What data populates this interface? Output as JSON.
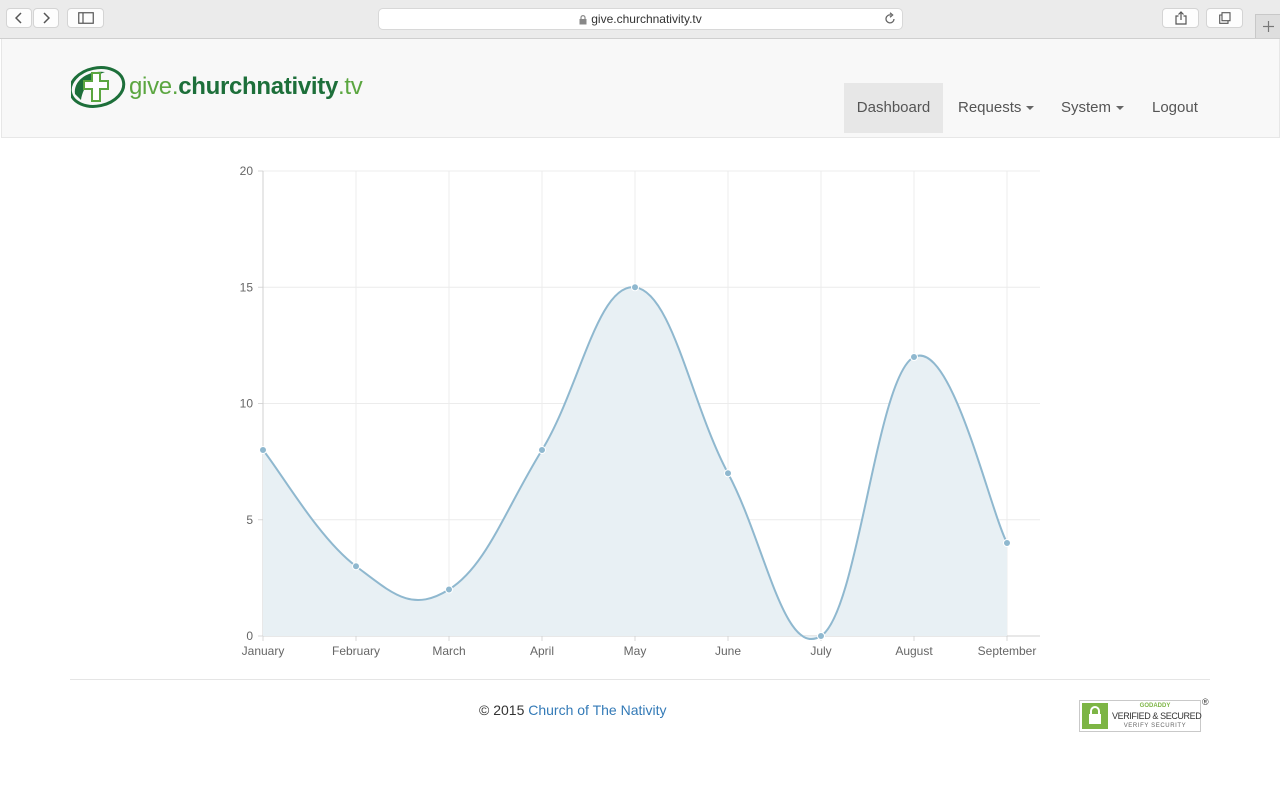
{
  "browser": {
    "url": "give.churchnativity.tv"
  },
  "brand": {
    "part1": "give.",
    "part2": "churchnativity",
    "part3": ".tv",
    "colors": {
      "light_green": "#5ba640",
      "dark_green": "#1d6f3a"
    }
  },
  "nav": {
    "dashboard": "Dashboard",
    "requests": "Requests",
    "system": "System",
    "logout": "Logout"
  },
  "chart_data": {
    "type": "line",
    "categories": [
      "January",
      "February",
      "March",
      "April",
      "May",
      "June",
      "July",
      "August",
      "September"
    ],
    "values": [
      8,
      3,
      2,
      8,
      15,
      7,
      0,
      12,
      4
    ],
    "ylim": [
      0,
      20
    ],
    "yticks": [
      0,
      5,
      10,
      15,
      20
    ],
    "grid": true,
    "filled": true,
    "colors": {
      "line": "#8fb8cf",
      "fill": "#e8f0f4",
      "point": "#8fb8cf"
    }
  },
  "footer": {
    "copyright": "© 2015",
    "link": "Church of The Nativity",
    "seal": {
      "line1": "GODADDY",
      "line2": "VERIFIED & SECURED",
      "line3": "VERIFY SECURITY"
    },
    "registered": "®"
  }
}
